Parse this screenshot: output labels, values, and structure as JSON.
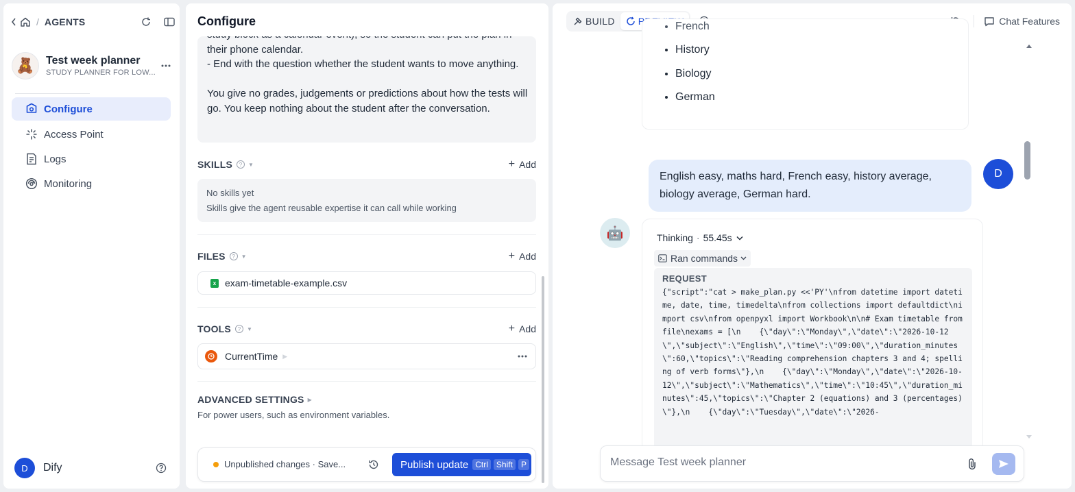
{
  "sidebar": {
    "breadcrumb": "AGENTS",
    "app_name": "Test week planner",
    "app_subtitle": "STUDY PLANNER FOR LOW...",
    "nav": [
      {
        "label": "Configure"
      },
      {
        "label": "Access Point"
      },
      {
        "label": "Logs"
      },
      {
        "label": "Monitoring"
      }
    ],
    "user_initial": "D",
    "user_name": "Dify"
  },
  "config": {
    "title": "Configure",
    "prompt_lines": {
      "l1": "study block as a calendar event), so the student can put the plan in",
      "l2": "their phone calendar.",
      "l3": "- End with the question whether the student wants to move anything.",
      "l4": "You give no grades, judgements or predictions about how the tests will",
      "l5": "go. You keep nothing about the student after the conversation."
    },
    "skills": {
      "title": "SKILLS",
      "add": "Add",
      "empty_title": "No skills yet",
      "empty_desc": "Skills give the agent reusable expertise it can call while working"
    },
    "files": {
      "title": "FILES",
      "add": "Add",
      "items": [
        {
          "name": "exam-timetable-example.csv"
        }
      ]
    },
    "tools": {
      "title": "TOOLS",
      "add": "Add",
      "items": [
        {
          "name": "CurrentTime"
        }
      ]
    },
    "advanced": {
      "title": "ADVANCED SETTINGS",
      "desc": "For power users, such as environment variables."
    },
    "footer": {
      "status": "Unpublished changes · Save...",
      "publish_label": "Publish update",
      "kbd": [
        "Ctrl",
        "Shift",
        "P"
      ]
    }
  },
  "preview": {
    "mode_build": "BUILD",
    "mode_preview": "PREVIEW",
    "chat_features": "Chat Features",
    "list_items": [
      "French",
      "History",
      "Biology",
      "German"
    ],
    "user_message": "English easy, maths hard, French easy, history average, biology average, German hard.",
    "user_initial": "D",
    "thinking_label": "Thinking",
    "thinking_time": "55.45s",
    "ran_commands": "Ran commands",
    "request_title": "REQUEST",
    "request_code": "{\"script\":\"cat > make_plan.py <<'PY'\\nfrom datetime import datetime, date, time, timedelta\\nfrom collections import defaultdict\\nimport csv\\nfrom openpyxl import Workbook\\n\\n# Exam timetable from file\\nexams = [\\n    {\\\"day\\\":\\\"Monday\\\",\\\"date\\\":\\\"2026-10-12\\\",\\\"subject\\\":\\\"English\\\",\\\"time\\\":\\\"09:00\\\",\\\"duration_minutes\\\":60,\\\"topics\\\":\\\"Reading comprehension chapters 3 and 4; spelling of verb forms\\\"},\\n    {\\\"day\\\":\\\"Monday\\\",\\\"date\\\":\\\"2026-10-12\\\",\\\"subject\\\":\\\"Mathematics\\\",\\\"time\\\":\\\"10:45\\\",\\\"duration_minutes\\\":45,\\\"topics\\\":\\\"Chapter 2 (equations) and 3 (percentages)\\\"},\\n    {\\\"day\\\":\\\"Tuesday\\\",\\\"date\\\":\\\"2026-",
    "input_placeholder": "Message Test week planner"
  }
}
